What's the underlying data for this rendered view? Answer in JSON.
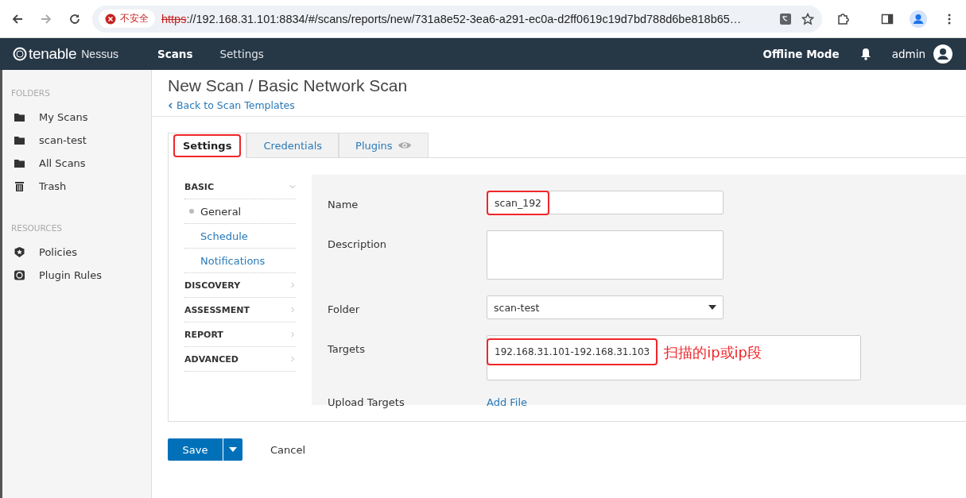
{
  "browser": {
    "security": "不安全",
    "url_scheme": "https",
    "url_rest": "://192.168.31.101:8834/#/scans/reports/new/731a8e52-3ea6-a291-ec0a-d2ff0619c19d7bd788d6be818b65…"
  },
  "nav": {
    "brand": "tenable",
    "product": "Nessus",
    "links": [
      {
        "label": "Scans",
        "selected": true
      },
      {
        "label": "Settings",
        "selected": false
      }
    ],
    "mode": "Offline Mode",
    "user": "admin"
  },
  "sidebar": [
    {
      "heading": "FOLDERS",
      "items": [
        {
          "label": "My Scans",
          "kind": "folder"
        },
        {
          "label": "scan-test",
          "kind": "folder"
        },
        {
          "label": "All Scans",
          "kind": "folder"
        },
        {
          "label": "Trash",
          "kind": "trash"
        }
      ]
    },
    {
      "heading": "RESOURCES",
      "items": [
        {
          "label": "Policies",
          "kind": "policy"
        },
        {
          "label": "Plugin Rules",
          "kind": "rule"
        }
      ]
    }
  ],
  "page": {
    "title": "New Scan / Basic Network Scan",
    "back_link": "Back to Scan Templates"
  },
  "tabs": [
    {
      "label": "Settings",
      "selected": true,
      "highlighted": true,
      "kind": "plain"
    },
    {
      "label": "Credentials",
      "selected": false,
      "highlighted": false,
      "kind": "plain"
    },
    {
      "label": "Plugins",
      "selected": false,
      "highlighted": false,
      "kind": "eye"
    }
  ],
  "menu": [
    {
      "label": "BASIC",
      "expanded": true,
      "children": [
        {
          "label": "General",
          "selected": true
        },
        {
          "label": "Schedule",
          "selected": false
        },
        {
          "label": "Notifications",
          "selected": false
        }
      ]
    },
    {
      "label": "DISCOVERY",
      "expanded": false
    },
    {
      "label": "ASSESSMENT",
      "expanded": false
    },
    {
      "label": "REPORT",
      "expanded": false
    },
    {
      "label": "ADVANCED",
      "expanded": false
    }
  ],
  "fields": [
    {
      "kind": "text",
      "label": "Name",
      "value": "scan_192",
      "highlighted": true
    },
    {
      "kind": "textarea",
      "label": "Description"
    },
    {
      "kind": "select",
      "label": "Folder",
      "value": "scan-test"
    },
    {
      "kind": "wide-textarea",
      "label": "Targets",
      "value": "192.168.31.101-192.168.31.103",
      "highlighted": true,
      "note": "扫描的ip或ip段"
    },
    {
      "kind": "link",
      "label": "Upload Targets",
      "value": "Add File"
    }
  ],
  "buttons": {
    "save": "Save",
    "cancel": "Cancel"
  }
}
